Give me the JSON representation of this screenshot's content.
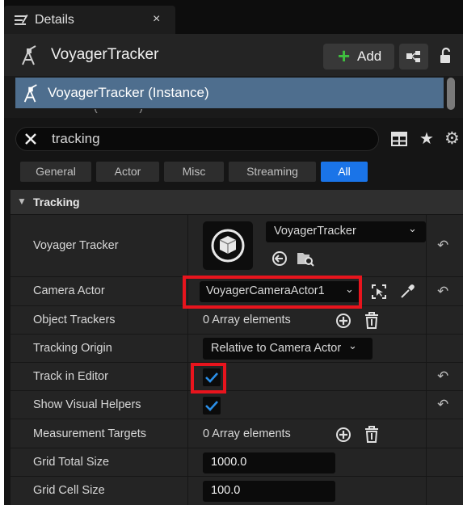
{
  "tab": {
    "title": "Details",
    "close": "×"
  },
  "header": {
    "actor_name": "VoyagerTracker",
    "add_label": "Add",
    "add_plus": "+"
  },
  "components": {
    "selected_label": "VoyagerTracker (Instance)",
    "cut_text": "  ·   ~      ~     ·     ·  (~     ~      ·    ·)               ~  ·  ·  ·"
  },
  "search": {
    "value": "tracking",
    "star": "★",
    "gear": "⚙"
  },
  "filters": [
    {
      "label": "General",
      "active": false
    },
    {
      "label": "Actor",
      "active": false
    },
    {
      "label": "Misc",
      "active": false
    },
    {
      "label": "Streaming",
      "active": false
    },
    {
      "label": "All",
      "active": true
    }
  ],
  "category": {
    "label": "Tracking",
    "arrow": "▼"
  },
  "properties": {
    "voyager_tracker": {
      "name": "Voyager Tracker",
      "value": "VoyagerTracker",
      "arrow": "⌄"
    },
    "camera_actor": {
      "name": "Camera Actor",
      "value": "VoyagerCameraActor1",
      "arrow": "⌄"
    },
    "object_trackers": {
      "name": "Object Trackers",
      "value": "0 Array elements"
    },
    "tracking_origin": {
      "name": "Tracking Origin",
      "value": "Relative to Camera Actor",
      "arrow": "⌄"
    },
    "track_in_editor": {
      "name": "Track in Editor",
      "checked": true
    },
    "show_visual_helpers": {
      "name": "Show Visual Helpers",
      "checked": true
    },
    "measurement_targets": {
      "name": "Measurement Targets",
      "value": "0 Array elements"
    },
    "grid_total_size": {
      "name": "Grid Total Size",
      "value": "1000.0"
    },
    "grid_cell_size": {
      "name": "Grid Cell Size",
      "value": "100.0"
    }
  },
  "reset_glyph": "↶",
  "colors": {
    "highlight_red": "#e8141d",
    "selection_blue": "#4e6e8e",
    "active_filter": "#1a74e8",
    "add_green": "#3fbf3f",
    "checkbox_blue": "#2b8fe8"
  }
}
